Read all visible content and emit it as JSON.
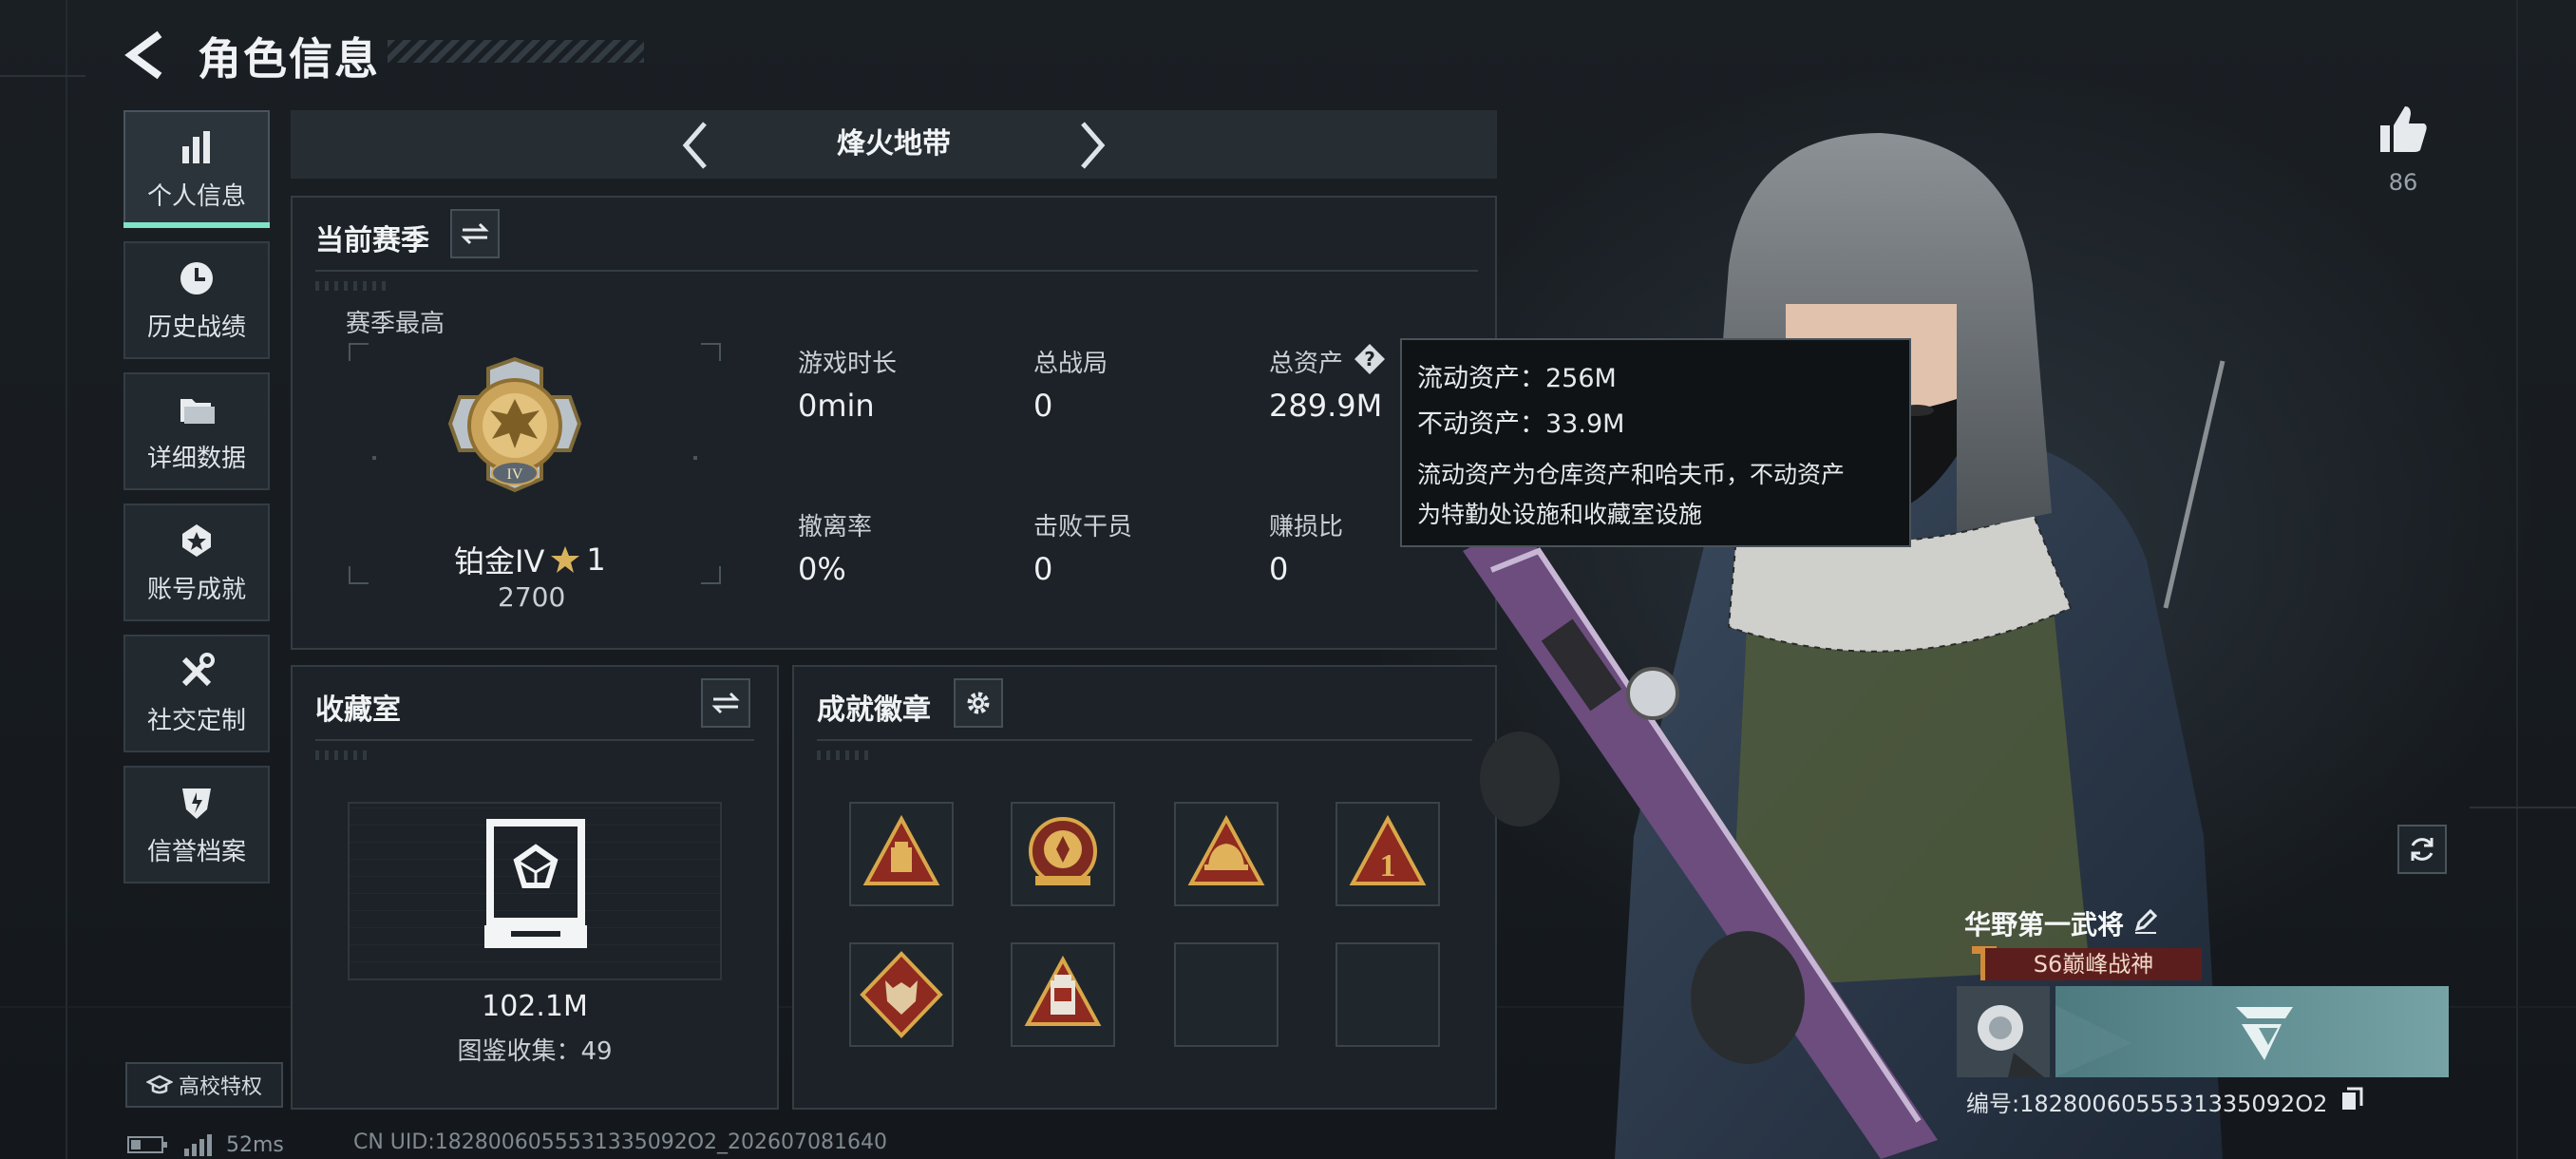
{
  "header": {
    "title": "角色信息"
  },
  "nav": {
    "items": [
      {
        "label": "个人信息",
        "icon": "bar-chart-icon",
        "active": true
      },
      {
        "label": "历史战绩",
        "icon": "clock-icon"
      },
      {
        "label": "详细数据",
        "icon": "folder-icon"
      },
      {
        "label": "账号成就",
        "icon": "medal-icon"
      },
      {
        "label": "社交定制",
        "icon": "tools-icon"
      },
      {
        "label": "信誉档案",
        "icon": "shield-icon"
      }
    ],
    "campus_label": "高校特权"
  },
  "status_bar": {
    "ping": "52ms",
    "uid": "CN UID:1828006055531335092O2_202607081640"
  },
  "mode": {
    "name": "烽火地带"
  },
  "season": {
    "title": "当前赛季",
    "best_label": "赛季最高",
    "rank_name": "铂金IV",
    "rank_emblem_text": "IV",
    "stars": "1",
    "score": "2700",
    "stats": [
      {
        "label": "游戏时长",
        "value": "0min"
      },
      {
        "label": "总战局",
        "value": "0"
      },
      {
        "label": "总资产",
        "value": "289.9M"
      },
      {
        "label": "撤离率",
        "value": "0%"
      },
      {
        "label": "击败干员",
        "value": "0"
      },
      {
        "label": "赚损比",
        "value": "0"
      }
    ]
  },
  "tooltip": {
    "line1": "流动资产：256M",
    "line2": "不动资产：33.9M",
    "line3": "流动资产为仓库资产和哈夫币，不动资产",
    "line4": "为特勤处设施和收藏室设施"
  },
  "collection": {
    "title": "收藏室",
    "value": "102.1M",
    "catalog": "图鉴收集：49"
  },
  "achievements": {
    "title": "成就徽章",
    "badge_number": "1",
    "badges": [
      "supply-badge",
      "emblem-badge",
      "helmet-badge",
      "number-one-badge",
      "wolf-badge",
      "canister-badge",
      "empty",
      "empty"
    ]
  },
  "likes": {
    "count": "86"
  },
  "player": {
    "nickname": "华野第一武将",
    "rank_tag": "S6巅峰战神",
    "id": "编号:1828006055531335092O2"
  },
  "colors": {
    "accent": "#7fe3c8",
    "bg": "#171c21",
    "panel": "#1c2227",
    "rank_tag": "#5c1e1c"
  }
}
